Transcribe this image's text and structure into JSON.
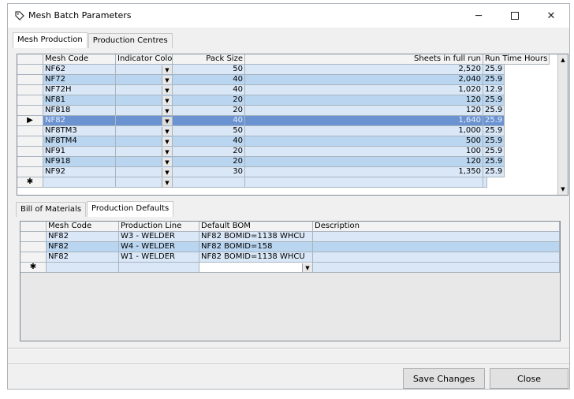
{
  "window": {
    "title": "Mesh Batch Parameters"
  },
  "top_tabs": [
    "Mesh Production",
    "Production Centres"
  ],
  "main_grid": {
    "columns": [
      "Mesh Code",
      "Indicator Color",
      "Pack Size",
      "Sheets in full run",
      "Run Time Hours"
    ],
    "rows": [
      {
        "code": "NF62",
        "pack": "50",
        "sheets": "2,520",
        "hours": "25.9"
      },
      {
        "code": "NF72",
        "pack": "40",
        "sheets": "2,040",
        "hours": "25.9"
      },
      {
        "code": "NF72H",
        "pack": "40",
        "sheets": "1,020",
        "hours": "12.9"
      },
      {
        "code": "NF81",
        "pack": "20",
        "sheets": "120",
        "hours": "25.9"
      },
      {
        "code": "NF818",
        "pack": "20",
        "sheets": "120",
        "hours": "25.9"
      },
      {
        "code": "NF82",
        "pack": "40",
        "sheets": "1,640",
        "hours": "25.9"
      },
      {
        "code": "NF8TM3",
        "pack": "50",
        "sheets": "1,000",
        "hours": "25.9"
      },
      {
        "code": "NF8TM4",
        "pack": "40",
        "sheets": "500",
        "hours": "25.9"
      },
      {
        "code": "NF91",
        "pack": "20",
        "sheets": "100",
        "hours": "25.9"
      },
      {
        "code": "NF918",
        "pack": "20",
        "sheets": "120",
        "hours": "25.9"
      },
      {
        "code": "NF92",
        "pack": "30",
        "sheets": "1,350",
        "hours": "25.9"
      }
    ],
    "selected_index": 5,
    "new_row_marker": "✱",
    "current_row_marker": "▶"
  },
  "sub_tabs": [
    "Bill of Materials",
    "Production Defaults"
  ],
  "sub_grid": {
    "columns": [
      "Mesh Code",
      "Production Line",
      "Default BOM",
      "Description"
    ],
    "rows": [
      {
        "code": "NF82",
        "line": "W3 - WELDER",
        "bom": "NF82 BOMID=1138 WHCU",
        "desc": ""
      },
      {
        "code": "NF82",
        "line": "W4 - WELDER",
        "bom": "NF82 BOMID=158",
        "desc": ""
      },
      {
        "code": "NF82",
        "line": "W1 - WELDER",
        "bom": "NF82 BOMID=1138 WHCU",
        "desc": ""
      }
    ],
    "new_row_marker": "✱"
  },
  "buttons": {
    "save": "Save Changes",
    "close": "Close"
  },
  "icons": {
    "app": "tag-icon",
    "minimize": "─",
    "close": "✕",
    "dropdown": "▼",
    "scroll_up": "▲",
    "scroll_down": "▼"
  },
  "colors": {
    "row_light": "#d9e7f7",
    "row_dark": "#b9d5ef",
    "row_selected": "#6b93d2"
  }
}
